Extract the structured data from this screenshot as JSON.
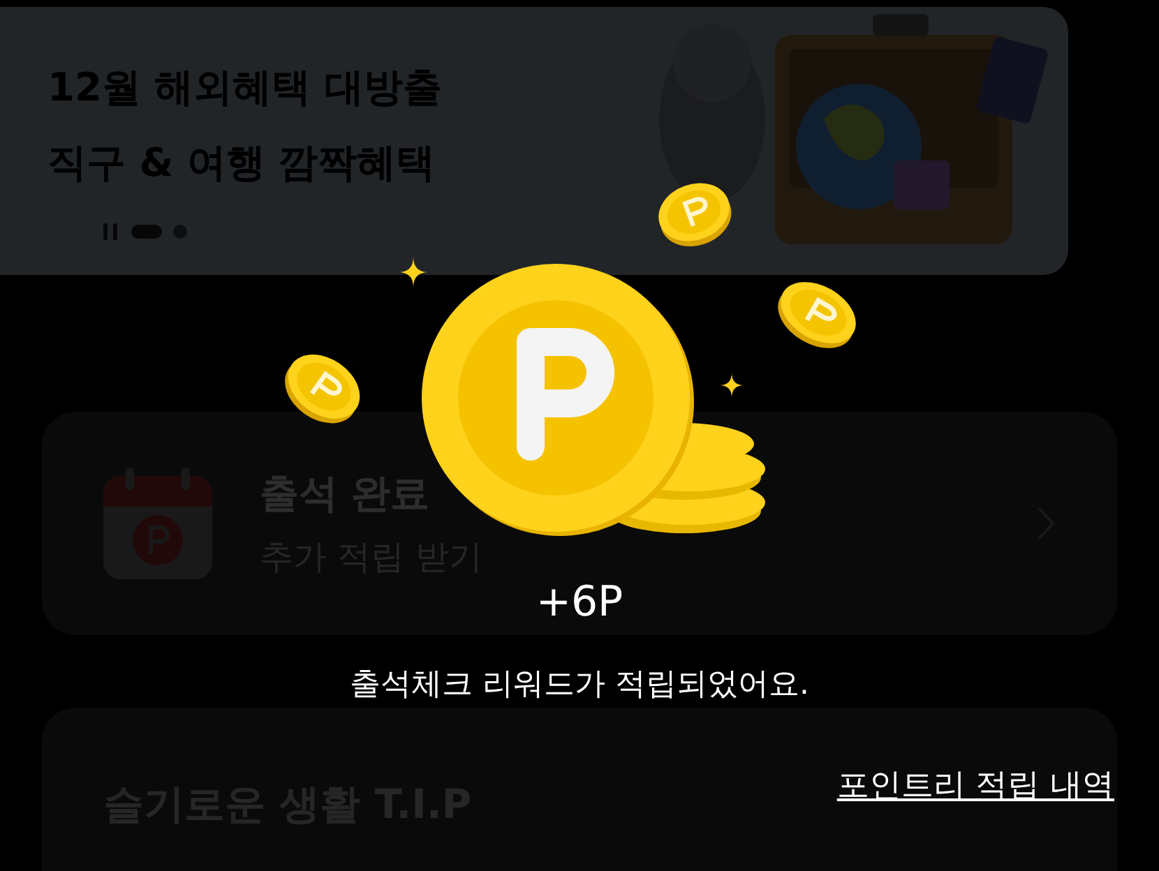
{
  "banner": {
    "title_lines": [
      "12월 해외혜택 대방출",
      "직구 & 여행 깜짝혜택"
    ],
    "indicators": [
      {
        "selected": true
      },
      {
        "selected": false
      }
    ]
  },
  "attendance": {
    "title": "출석 완료",
    "subtitle": "추가 적립 받기"
  },
  "tips": {
    "title": "슬기로운 생활 T.I.P"
  },
  "reward": {
    "amount": "+6P",
    "message": "출석체크 리워드가 적립되었어요.",
    "link": "포인트리 적립 내역"
  }
}
